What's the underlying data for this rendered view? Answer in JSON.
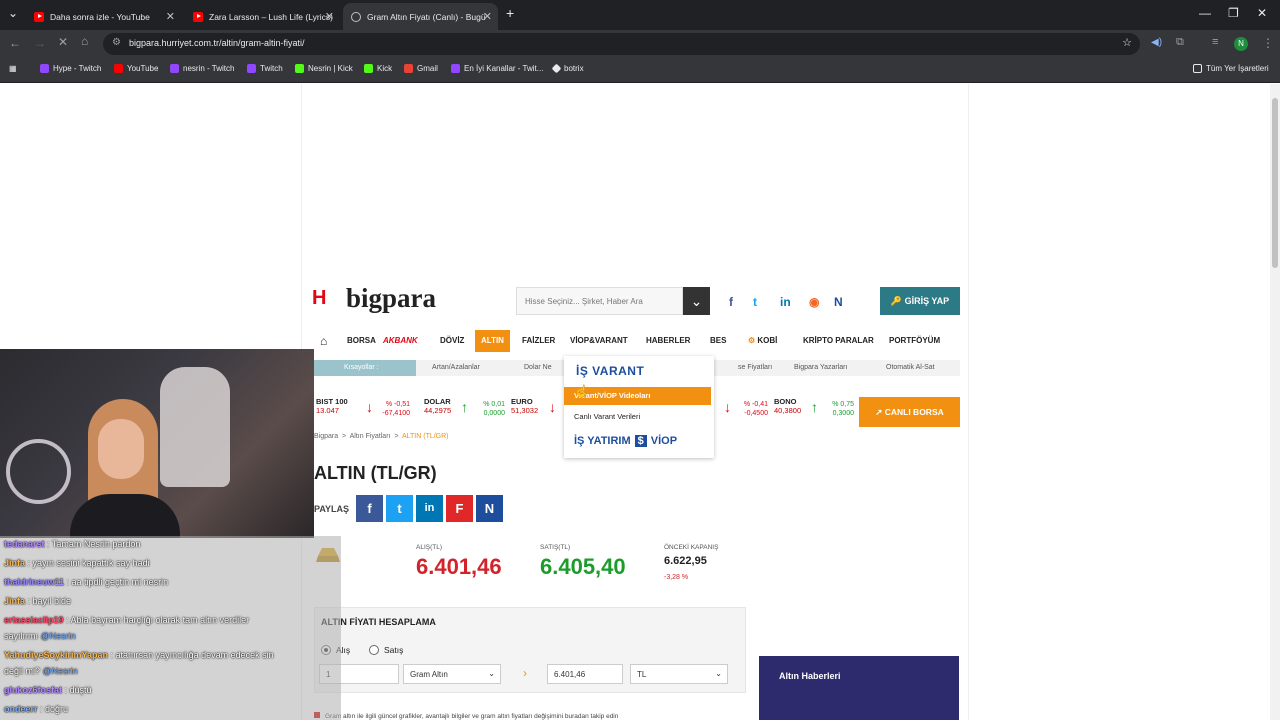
{
  "browser": {
    "tabs": [
      {
        "title": "Daha sonra izle - YouTube",
        "icon": "youtube-icon"
      },
      {
        "title": "Zara Larsson – Lush Life (Lyrics)",
        "icon": "youtube-icon"
      },
      {
        "title": "Gram Altın Fiyatı (Canlı) - Bugü",
        "icon": "globe-icon"
      }
    ],
    "url": "bigpara.hurriyet.com.tr/altin/gram-altin-fiyati/",
    "bookmarks": [
      "Hype - Twitch",
      "YouTube",
      "nesrin - Twitch",
      "Twitch",
      "Nesrin | Kick",
      "Kick",
      "Gmail",
      "En İyi Kanallar - Twit...",
      "botrix"
    ],
    "all_bookmarks": "Tüm Yer İşaretleri",
    "profile_initial": "N"
  },
  "site": {
    "logo_letter": "H",
    "logo_text": "bigpara",
    "search_placeholder": "Hisse Seçiniz... Şirket, Haber Ara",
    "login_label": "GİRİŞ YAP",
    "nav": [
      "BORSA",
      "AKBANK",
      "DÖVİZ",
      "ALTIN",
      "FAİZLER",
      "VİOP&VARANT",
      "HABERLER",
      "BES",
      "KOBİ",
      "KRİPTO PARALAR",
      "PORTFÖYÜM"
    ],
    "subnav": {
      "label": "Kısayollar :",
      "items": [
        "Artan/Azalanlar",
        "Dolar Ne",
        "se Fiyatları",
        "Bigpara Yazarları",
        "Otomatik Al-Sat"
      ]
    },
    "dropdown": {
      "brand_top": "İŞ VARANT",
      "items": [
        "Varant/VİOP Videoları",
        "Canlı Varant Verileri"
      ],
      "brand_bottom_a": "İŞ YATIRIM",
      "brand_bottom_b": "VİOP"
    },
    "ticker": [
      {
        "name": "BIST 100",
        "value": "13.047",
        "pct": "% -0,51",
        "chg": "-67,4100",
        "dir": "down"
      },
      {
        "name": "DOLAR",
        "value": "44,2975",
        "pct": "% 0,01",
        "chg": "0,0000",
        "dir": "up"
      },
      {
        "name": "EURO",
        "value": "51,3032",
        "pct": "",
        "chg": "",
        "dir": "down"
      },
      {
        "name": "",
        "value": "",
        "pct": "% -0,41",
        "chg": "-0,4500",
        "dir": "down"
      },
      {
        "name": "BONO",
        "value": "40,3800",
        "pct": "% 0,75",
        "chg": "0,3000",
        "dir": "up"
      }
    ],
    "canli_borsa": "CANLI BORSA",
    "breadcrumb": [
      "Bigpara",
      "Altın Fiyatları",
      "ALTIN (TL/GR)"
    ],
    "title": "ALTIN (TL/GR)",
    "share_label": "PAYLAŞ",
    "prices": {
      "buy_label": "ALIŞ(TL)",
      "buy": "6.401,46",
      "sell_label": "SATIŞ(TL)",
      "sell": "6.405,40",
      "prev_label": "ÖNCEKİ KAPANIŞ",
      "prev": "6.622,95",
      "prev_change": "-3,28 %"
    },
    "calc": {
      "title": "ALTIN FİYATI HESAPLAMA",
      "radio_buy": "Alış",
      "radio_sell": "Satış",
      "qty": "1",
      "type": "Gram Altın",
      "result": "6.401,46",
      "currency": "TL"
    },
    "news_title": "Altın Haberleri",
    "footnote": "Gram altın ile ilgili güncel grafikler, avantajlı bilgiler ve gram altın fiyatları değişimini buradan takip edin"
  },
  "chat": [
    {
      "user": "tedanarst",
      "msg": ": Tamam Nesrin pardon",
      "color": "#b48cff"
    },
    {
      "user": "Jinfa",
      "msg": ": yayın sesini kapattık say hadi",
      "color": "#ffb84d"
    },
    {
      "user": "thaldrineuw11",
      "msg": ": aa tipdli geçtin mi nesrin",
      "color": "#9b8cff"
    },
    {
      "user": "Jinfa",
      "msg": ": bayıl bide",
      "color": "#ffb84d"
    },
    {
      "user": "ertassiaclip19",
      "msg": ": Abla bayram harçlığı olarak tam altın verdiler",
      "color": "#ff4d6d"
    },
    {
      "user": "",
      "msg": "sayılırmı",
      "mention": "@Nesrin",
      "color": "#ffffff"
    },
    {
      "user": "YahudiyeSoykirimYapan",
      "msg": ": atanırsan yayıncılığa devam edecek sin",
      "color": "#ffb84d"
    },
    {
      "user": "",
      "msg": "değil mi?",
      "mention": "@Nesrin",
      "color": "#ffffff"
    },
    {
      "user": "glukoz6fosfat",
      "msg": ": düştü",
      "color": "#b48cff"
    },
    {
      "user": "ondeerr",
      "msg": ": doğru",
      "color": "#7fb1ff"
    }
  ]
}
